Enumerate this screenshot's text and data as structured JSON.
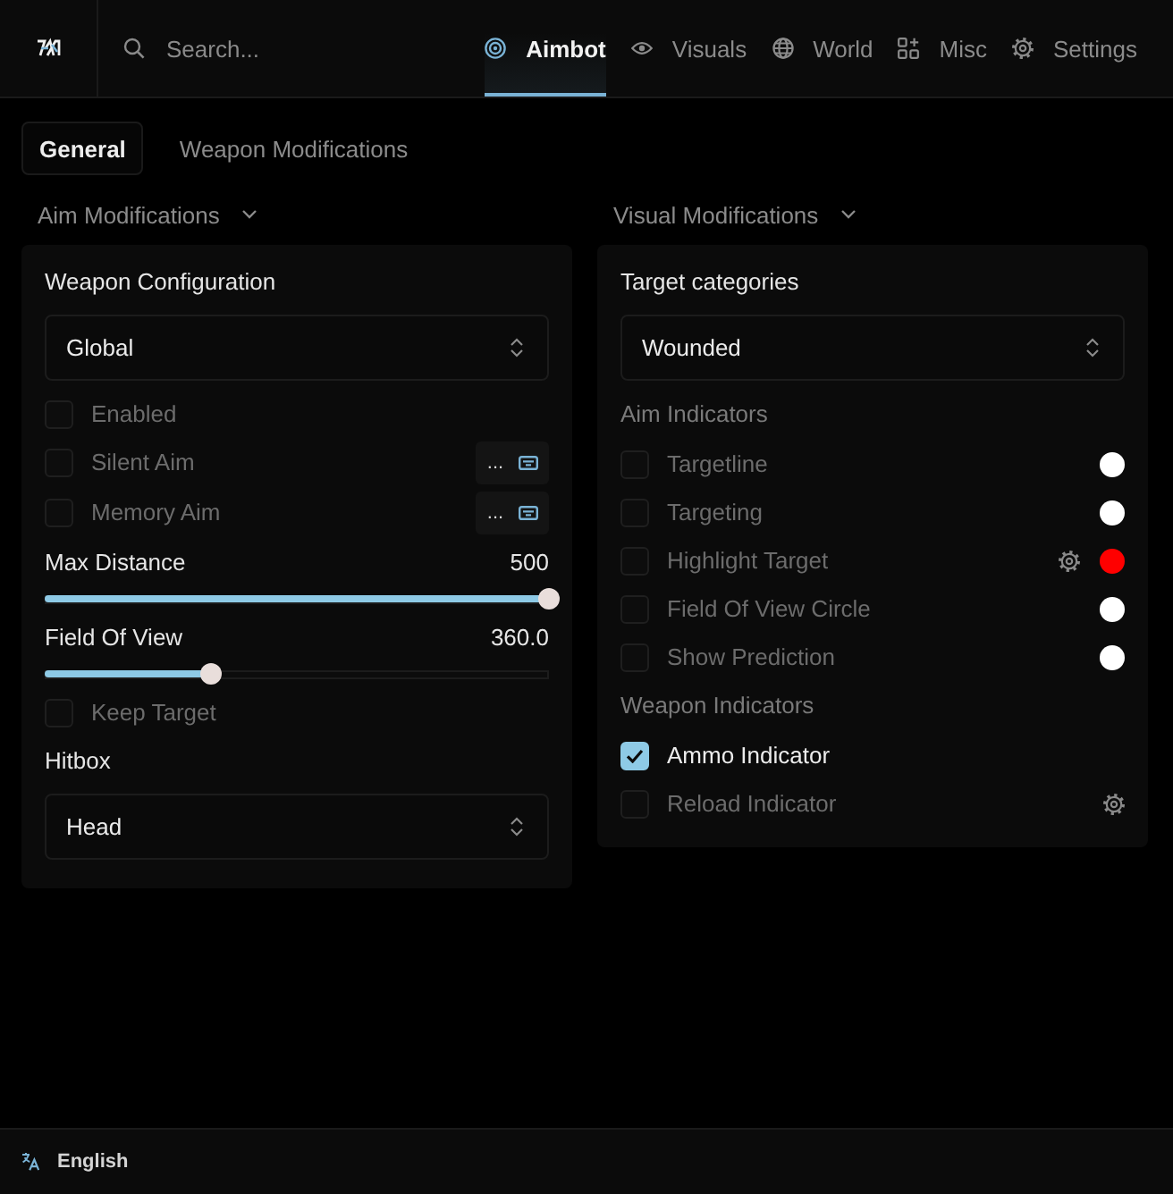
{
  "top_bar": {
    "search": {
      "placeholder": "Search..."
    },
    "tabs": [
      {
        "label": "Aimbot",
        "selected": true
      },
      {
        "label": "Visuals",
        "selected": false
      },
      {
        "label": "World",
        "selected": false
      },
      {
        "label": "Misc",
        "selected": false
      },
      {
        "label": "Settings",
        "selected": false
      }
    ]
  },
  "sub_tabs": [
    {
      "label": "General",
      "selected": true
    },
    {
      "label": "Weapon Modifications",
      "selected": false
    }
  ],
  "panels": [
    {
      "title": "Aim Modifications",
      "items": [
        {
          "kind": "select",
          "label": "Weapon Configuration",
          "value": "Global"
        },
        {
          "kind": "checkbox",
          "label": "Enabled",
          "checked": false
        },
        {
          "kind": "checkbox",
          "label": "Silent Aim",
          "checked": false,
          "keybind": "..."
        },
        {
          "kind": "checkbox",
          "label": "Memory Aim",
          "checked": false,
          "keybind": "..."
        },
        {
          "kind": "slider",
          "label": "Max Distance",
          "reading": "500",
          "level": 1
        },
        {
          "kind": "slider",
          "label": "Field Of View",
          "reading": "360.0",
          "level": 0.33
        },
        {
          "kind": "checkbox",
          "label": "Keep Target",
          "checked": false
        },
        {
          "kind": "select",
          "label": "Hitbox",
          "value": "Head"
        }
      ]
    },
    {
      "title": "Visual Modifications",
      "items": [
        {
          "kind": "select",
          "label": "Target categories",
          "value": "Wounded"
        },
        {
          "kind": "heading",
          "label": "Aim Indicators"
        },
        {
          "kind": "checkbox",
          "label": "Targetline",
          "checked": false,
          "color": "#ffffff"
        },
        {
          "kind": "checkbox",
          "label": "Targeting",
          "checked": false,
          "color": "#ffffff"
        },
        {
          "kind": "checkbox",
          "label": "Highlight Target",
          "checked": false,
          "settings": true,
          "color": "#ff0000"
        },
        {
          "kind": "checkbox",
          "label": "Field Of View Circle",
          "checked": false,
          "color": "#ffffff"
        },
        {
          "kind": "checkbox",
          "label": "Show Prediction",
          "checked": false,
          "color": "#ffffff"
        },
        {
          "kind": "heading",
          "label": "Weapon Indicators"
        },
        {
          "kind": "checkbox",
          "label": "Ammo Indicator",
          "checked": true
        },
        {
          "kind": "checkbox",
          "label": "Reload Indicator",
          "checked": false,
          "settings": true
        }
      ]
    }
  ],
  "footer": {
    "language": "English"
  }
}
